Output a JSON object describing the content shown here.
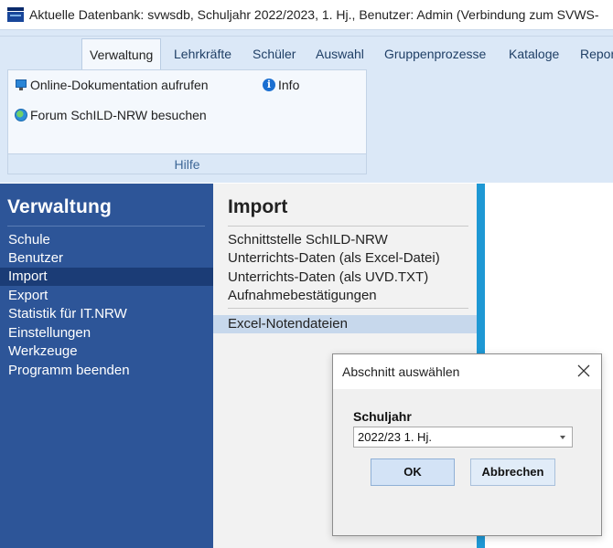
{
  "window": {
    "title": "Aktuelle Datenbank: svwsdb, Schuljahr 2022/2023, 1. Hj., Benutzer: Admin (Verbindung zum SVWS-"
  },
  "ribbon": {
    "tabs": [
      {
        "label": "Verwaltung",
        "active": true
      },
      {
        "label": "Lehrkräfte",
        "active": false
      },
      {
        "label": "Schüler",
        "active": false
      },
      {
        "label": "Auswahl",
        "active": false
      },
      {
        "label": "Gruppenprozesse",
        "active": false
      },
      {
        "label": "Kataloge",
        "active": false
      },
      {
        "label": "Repor",
        "active": false
      }
    ],
    "group": {
      "label": "Hilfe",
      "items": {
        "online_doc": {
          "label": "Online-Dokumentation aufrufen",
          "icon": "monitor-icon"
        },
        "info": {
          "label": "Info",
          "icon": "info-icon"
        },
        "forum": {
          "label": "Forum SchILD-NRW besuchen",
          "icon": "globe-icon"
        }
      }
    }
  },
  "nav": {
    "heading": "Verwaltung",
    "items": [
      {
        "label": "Schule"
      },
      {
        "label": "Benutzer"
      },
      {
        "label": "Import",
        "selected": true
      },
      {
        "label": "Export"
      },
      {
        "label": "Statistik für IT.NRW"
      },
      {
        "label": "Einstellungen"
      },
      {
        "label": "Werkzeuge"
      },
      {
        "label": "Programm beenden"
      }
    ]
  },
  "import_panel": {
    "heading": "Import",
    "items": [
      {
        "label": "Schnittstelle SchILD-NRW"
      },
      {
        "label": "Unterrichts-Daten (als Excel-Datei)"
      },
      {
        "label": "Unterrichts-Daten (als UVD.TXT)"
      },
      {
        "label": "Aufnahmebestätigungen"
      }
    ],
    "selected_item": {
      "label": "Excel-Notendateien"
    }
  },
  "dialog": {
    "title": "Abschnitt auswählen",
    "field_label": "Schuljahr",
    "select_value": "2022/23 1. Hj.",
    "ok_label": "OK",
    "cancel_label": "Abbrechen"
  },
  "colors": {
    "nav_bg": "#2d5598",
    "nav_selected": "#1b3c76",
    "accent": "#1e98d4",
    "ribbon_bg": "#dbe8f7"
  }
}
